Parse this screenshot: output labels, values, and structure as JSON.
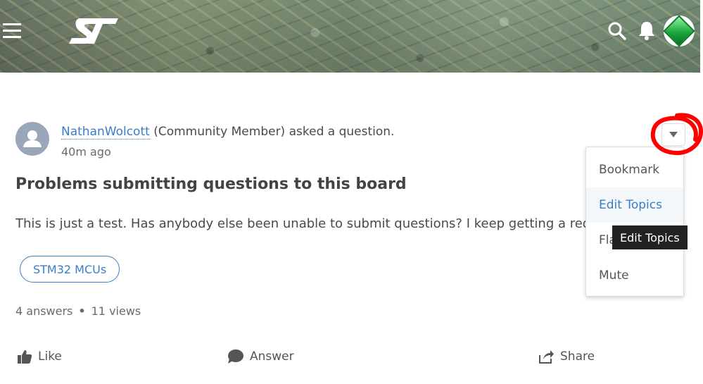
{
  "header": {
    "logo_text": "ST",
    "avatar_alt": "user avatar",
    "icons": {
      "menu": "hamburger-icon",
      "search": "search-icon",
      "notifications": "bell-icon"
    }
  },
  "post": {
    "author": "NathanWolcott",
    "author_role": "(Community Member) asked a question.",
    "time": "40m ago",
    "title": "Problems submitting questions to this board",
    "body": "This is just a test. Has anybody else been unable to submit questions? I keep getting a red error",
    "topic": "STM32 MCUs",
    "answers": "4 answers",
    "views": "11 views",
    "stats_sep": "•"
  },
  "actions": {
    "like": "Like",
    "answer": "Answer",
    "share": "Share"
  },
  "menu": {
    "items": [
      {
        "label": "Bookmark"
      },
      {
        "label": "Edit Topics"
      },
      {
        "label": "Flag"
      },
      {
        "label": "Mute"
      }
    ],
    "tooltip": "Edit Topics"
  },
  "colors": {
    "link": "#3a7dc9",
    "annotation": "#ff0000"
  }
}
